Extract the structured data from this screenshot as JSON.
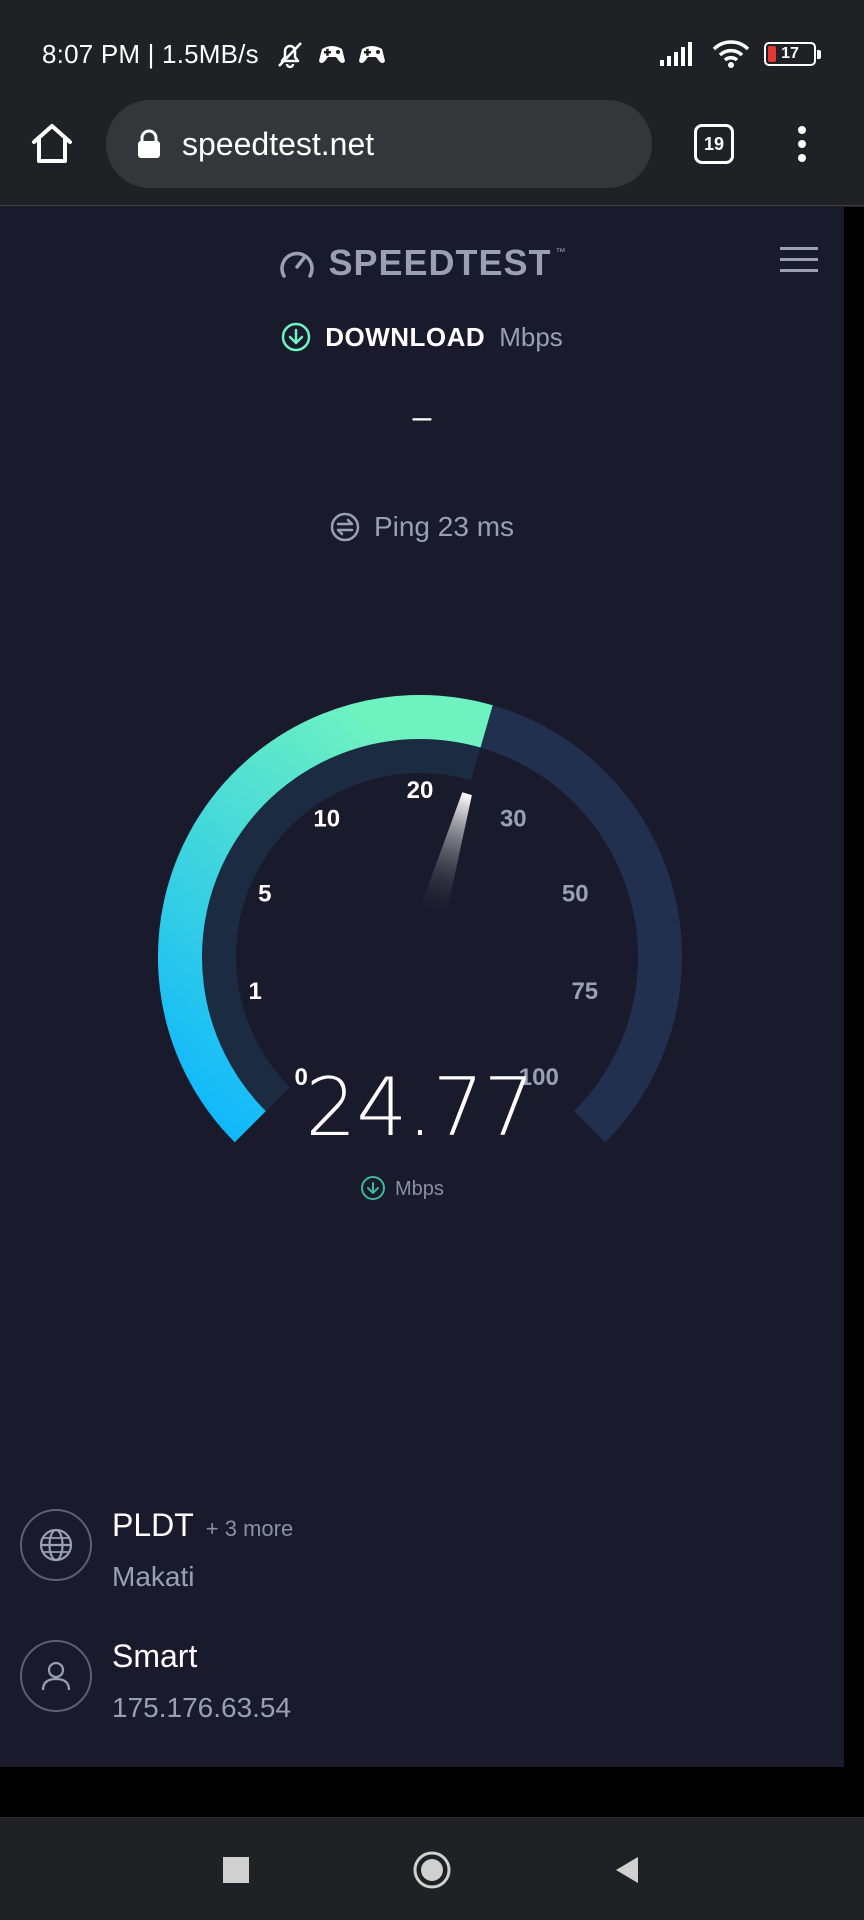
{
  "status_bar": {
    "time": "8:07 PM | 1.5MB/s",
    "battery_level": "17",
    "battery_fraction": 0.17,
    "icons": [
      "mute-notifications-icon",
      "game-controller-icon",
      "game-controller-icon",
      "signal-icon",
      "wifi-icon",
      "battery-icon"
    ]
  },
  "browser": {
    "url": "speedtest.net",
    "tab_count": "19",
    "icons": [
      "home-icon",
      "lock-icon",
      "tabs-icon",
      "overflow-menu-icon"
    ]
  },
  "page": {
    "brand": "SPEEDTEST",
    "brand_mark": "™",
    "download_label": "DOWNLOAD",
    "download_unit": "Mbps",
    "download_value": "–",
    "ping_label": "Ping 23 ms",
    "gauge": {
      "reading": "24.77",
      "unit": "Mbps",
      "ticks": [
        "0",
        "1",
        "5",
        "10",
        "20",
        "30",
        "50",
        "75",
        "100"
      ],
      "tick_values": [
        0,
        1,
        5,
        10,
        20,
        30,
        50,
        75,
        100
      ],
      "current_value": 24.77,
      "colors": {
        "active_start": "#0bb5ff",
        "active_end": "#6ef2c0",
        "track": "#223050",
        "active_tick": "#ffffff",
        "inactive_tick": "#9aa0b4"
      }
    },
    "isp": {
      "name": "PLDT",
      "more": "+ 3 more",
      "location": "Makati"
    },
    "client": {
      "name": "Smart",
      "ip": "175.176.63.54"
    }
  },
  "nav": {
    "icons": [
      "recents-square-icon",
      "home-circle-icon",
      "back-triangle-icon"
    ]
  }
}
